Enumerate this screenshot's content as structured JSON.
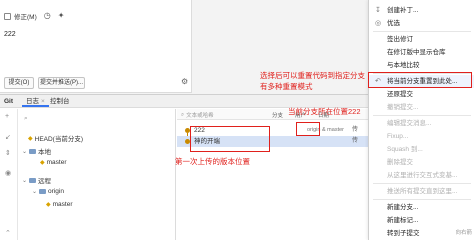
{
  "commit_panel": {
    "amend_label": "修正(M)",
    "message": "222",
    "commit_label": "提交(O)",
    "commit_push_label": "提交并推送(P)..."
  },
  "git_window": {
    "title": "Git",
    "tabs": [
      "日志",
      "控制台"
    ],
    "branch_tree": {
      "head": "HEAD(当前分支)",
      "local": "本地",
      "local_master": "master",
      "remote": "远程",
      "origin": "origin",
      "remote_master": "master"
    },
    "log": {
      "search_placeholder": "文本或哈希",
      "filters": [
        "分支",
        "用户",
        "日期"
      ],
      "rows": [
        {
          "message": "222",
          "refs": "origin & master",
          "author": "传"
        },
        {
          "message": "神的开端",
          "refs": "",
          "author": "传"
        }
      ]
    }
  },
  "annotations": {
    "reset_note_line1": "选择后可以重置代码到指定分支",
    "reset_note_line2": "有多种重置模式",
    "current_branch_note": "当前分支所在位置222",
    "first_commit_note": "第一次上传的版本位置"
  },
  "menu": {
    "items": [
      {
        "label": "创建补丁...",
        "icon": "↧",
        "disabled": false
      },
      {
        "label": "优选",
        "icon": "◎",
        "disabled": false
      },
      {
        "label": "签出修订",
        "icon": "",
        "disabled": false
      },
      {
        "label": "在修订版中显示仓库",
        "icon": "",
        "disabled": false
      },
      {
        "label": "与本地比较",
        "icon": "",
        "disabled": false
      },
      {
        "label": "将当前分支重置到此处...",
        "icon": "↶",
        "disabled": false,
        "highlight": true
      },
      {
        "label": "还原提交",
        "icon": "",
        "disabled": false
      },
      {
        "label": "撤销提交...",
        "icon": "",
        "disabled": true
      },
      {
        "label": "编辑提交消息...",
        "icon": "",
        "disabled": true
      },
      {
        "label": "Fixup...",
        "icon": "",
        "disabled": true
      },
      {
        "label": "Squash 到...",
        "icon": "",
        "disabled": true
      },
      {
        "label": "删除提交",
        "icon": "",
        "disabled": true
      },
      {
        "label": "从这里进行交互式变基...",
        "icon": "",
        "disabled": true
      },
      {
        "label": "推送所有提交直到这里...",
        "icon": "",
        "disabled": true
      },
      {
        "label": "新建分支...",
        "icon": "",
        "disabled": false
      },
      {
        "label": "新建标记...",
        "icon": "",
        "disabled": false
      },
      {
        "label": "转到子提交",
        "icon": "",
        "disabled": false
      }
    ],
    "shortcut": "向右箭"
  }
}
